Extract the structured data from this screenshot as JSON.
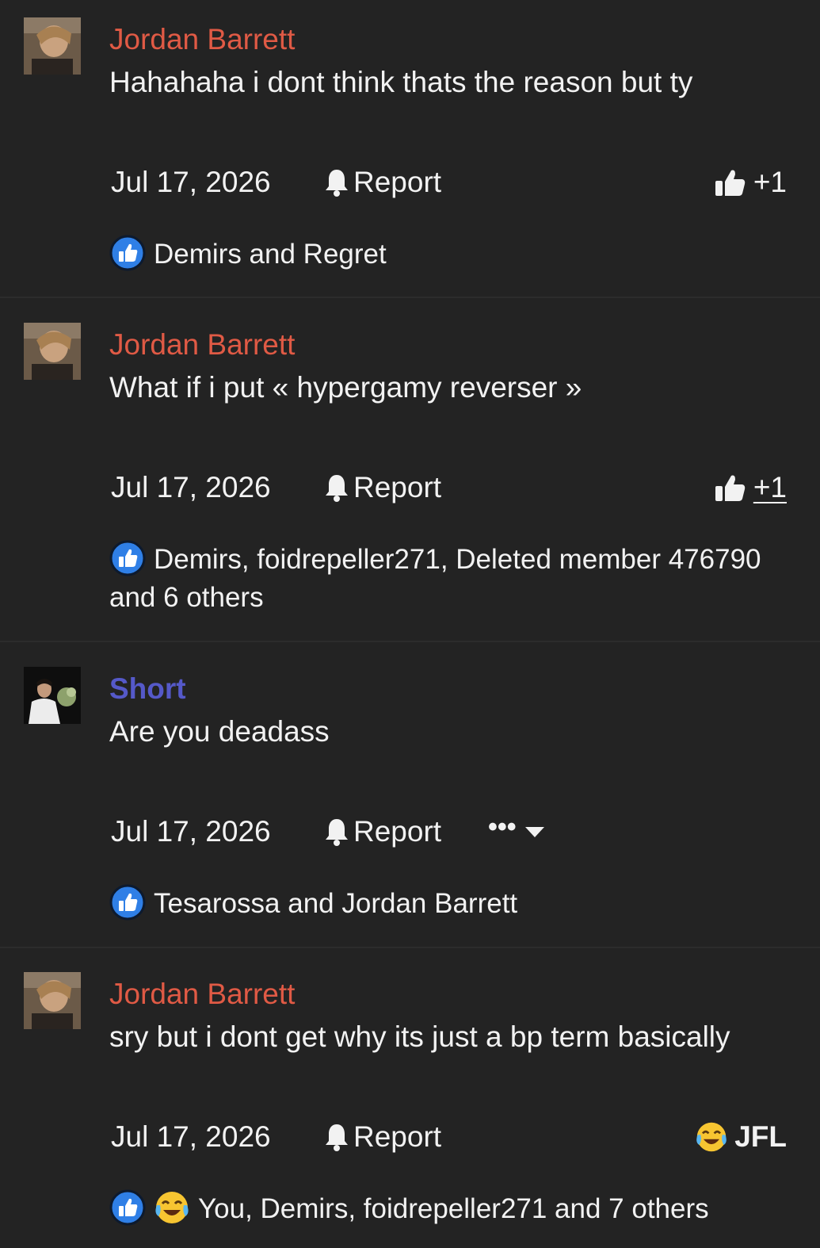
{
  "posts": [
    {
      "author": "Jordan Barrett",
      "message": "Hahahaha i dont think thats the reason but ty",
      "date": "Jul 17, 2026",
      "report_label": "Report",
      "reaction_button": "+1",
      "reactions_text": "Demirs and Regret"
    },
    {
      "author": "Jordan Barrett",
      "message": "What if i put « hypergamy reverser »",
      "date": "Jul 17, 2026",
      "report_label": "Report",
      "reaction_button": "+1",
      "reactions_text": "Demirs, foidrepeller271, Deleted member 476790 and 6 others"
    },
    {
      "author": "Short",
      "message": "Are you deadass",
      "date": "Jul 17, 2026",
      "report_label": "Report",
      "more_label": "•••",
      "reactions_text": "Tesarossa and Jordan Barrett"
    },
    {
      "author": "Jordan Barrett",
      "message": "sry but i dont get why its just a bp term basically",
      "date": "Jul 17, 2026",
      "report_label": "Report",
      "reaction_button": "JFL",
      "reactions_text": "You, Demirs, foidrepeller271 and 7 others"
    }
  ],
  "colors": {
    "background": "#232323",
    "author_red": "#e05a45",
    "author_blue": "#5559c9",
    "text": "#f2f2f2",
    "like_blue": "#2f7fe6"
  },
  "icons": [
    "bell-icon",
    "thumbs-up-icon",
    "like-reaction-icon",
    "laughing-crying-emoji-icon",
    "chevron-down-icon"
  ]
}
